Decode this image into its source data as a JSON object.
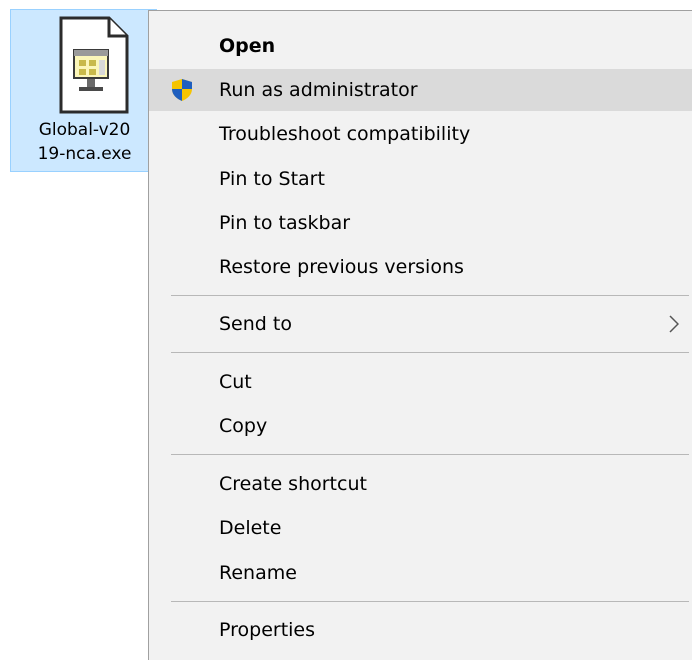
{
  "desktop": {
    "file": {
      "icon": "executable-file-icon",
      "name": "Global-v20\n19-nca.exe"
    }
  },
  "context_menu": {
    "items": [
      {
        "label": "Open",
        "bold": true
      },
      {
        "label": "Run as administrator",
        "icon": "uac-shield-icon",
        "highlighted": true
      },
      {
        "label": "Troubleshoot compatibility"
      },
      {
        "label": "Pin to Start"
      },
      {
        "label": "Pin to taskbar"
      },
      {
        "label": "Restore previous versions"
      },
      {
        "label": "Send to",
        "submenu_icon": "chevron-right-icon"
      },
      {
        "label": "Cut"
      },
      {
        "label": "Copy"
      },
      {
        "label": "Create shortcut"
      },
      {
        "label": "Delete"
      },
      {
        "label": "Rename"
      },
      {
        "label": "Properties"
      }
    ]
  },
  "colors": {
    "menu_background": "#f2f2f2",
    "highlight": "#dadada",
    "selection": "#cce8ff",
    "separator": "#b8b8b8",
    "shield_blue": "#1f5fbf",
    "shield_yellow": "#f5c400"
  }
}
